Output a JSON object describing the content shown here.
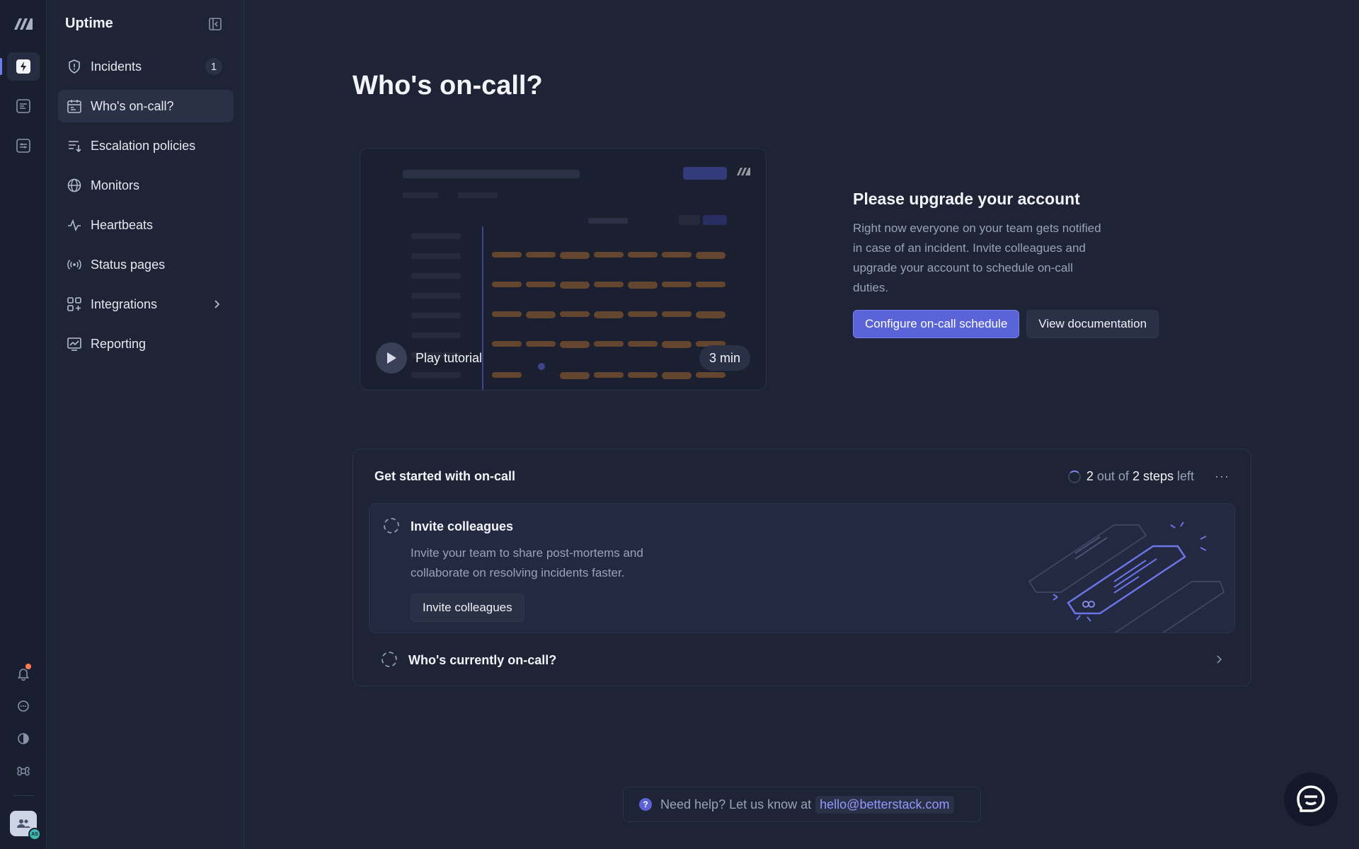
{
  "app": {
    "title": "Uptime"
  },
  "sidebar": {
    "items": [
      {
        "label": "Incidents",
        "icon": "shield-icon",
        "badge": "1"
      },
      {
        "label": "Who's on-call?",
        "icon": "calendar-icon",
        "active": true
      },
      {
        "label": "Escalation policies",
        "icon": "list-arrow-icon"
      },
      {
        "label": "Monitors",
        "icon": "globe-icon"
      },
      {
        "label": "Heartbeats",
        "icon": "pulse-icon"
      },
      {
        "label": "Status pages",
        "icon": "broadcast-icon"
      },
      {
        "label": "Integrations",
        "icon": "grid-plus-icon",
        "chevron": true
      },
      {
        "label": "Reporting",
        "icon": "chart-icon"
      }
    ]
  },
  "main": {
    "title": "Who's on-call?",
    "video": {
      "play_label": "Play tutorial",
      "duration": "3 min"
    },
    "upgrade": {
      "heading": "Please upgrade your account",
      "body": "Right now everyone on your team gets notified in case of an incident. Invite colleagues and upgrade your account to schedule on-call duties.",
      "primary_button": "Configure on-call schedule",
      "secondary_button": "View documentation"
    },
    "get_started": {
      "title": "Get started with on-call",
      "progress": {
        "done": "2",
        "mid": "out of",
        "total": "2 steps",
        "suffix": "left"
      },
      "more": "···",
      "steps": [
        {
          "title": "Invite colleagues",
          "description": "Invite your team to share post-mortems and collaborate on resolving incidents faster.",
          "button": "Invite colleagues"
        },
        {
          "title": "Who's currently on-call?"
        }
      ]
    }
  },
  "help": {
    "text": "Need help? Let us know at",
    "email": "hello@betterstack.com"
  },
  "user": {
    "initials": "AS"
  },
  "colors": {
    "accent": "#5a63d8",
    "background": "#1e2335",
    "notification": "#ff7a59"
  }
}
